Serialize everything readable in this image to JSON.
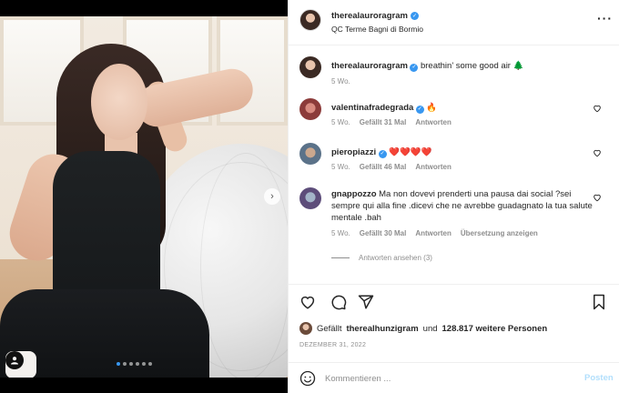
{
  "post": {
    "username": "therealauroragram",
    "location": "QC Terme Bagni di Bormio",
    "more_icon": "more-horizontal-icon"
  },
  "comments": [
    {
      "username": "therealauroragram",
      "verified": true,
      "text": "breathin' some good air 🌲",
      "time": "5 Wo."
    },
    {
      "username": "valentinafradegrada",
      "verified": true,
      "text": "🔥",
      "time": "5 Wo.",
      "likes": "Gefällt 31 Mal",
      "reply": "Antworten"
    },
    {
      "username": "pieropiazzi",
      "verified": true,
      "text": "❤️❤️❤️❤️",
      "time": "5 Wo.",
      "likes": "Gefällt 46 Mal",
      "reply": "Antworten"
    },
    {
      "username": "gnappozzo",
      "verified": false,
      "text": "Ma non dovevi prenderti una pausa dai social ?sei sempre qui alla fine .dicevi che ne avrebbe guadagnato la tua salute mentale .bah",
      "time": "5 Wo.",
      "likes": "Gefällt 30 Mal",
      "reply": "Antworten",
      "translate": "Übersetzung anzeigen"
    }
  ],
  "view_replies": "Antworten ansehen (3)",
  "likes_line": {
    "prefix": "Gefällt",
    "user": "therealhunzigram",
    "middle": "und",
    "count": "128.817 weitere Personen"
  },
  "date": "DEZEMBER 31, 2022",
  "composer": {
    "placeholder": "Kommentieren ...",
    "post_label": "Posten"
  },
  "carousel": {
    "slide_count": 6,
    "active_index": 0
  },
  "colors": {
    "accent": "#3897f0",
    "muted": "#8e8e8e",
    "text": "#262626",
    "post_disabled": "#b2dffc"
  }
}
